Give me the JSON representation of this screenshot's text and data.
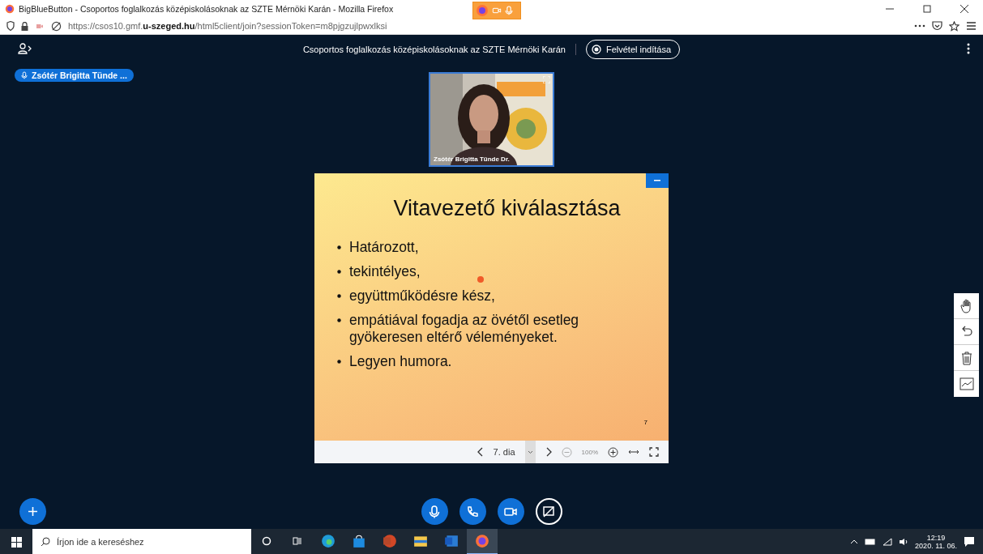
{
  "browser": {
    "title": "BigBlueButton - Csoportos foglalkozás középiskolásoknak az SZTE Mérnöki Karán - Mozilla Firefox",
    "url": "https://csos10.gmf.**u-szeged.hu**/html5client/join?sessionToken=m8pjgzujlpwxlksi"
  },
  "meeting": {
    "title": "Csoportos foglalkozás középiskolásoknak az SZTE Mérnöki Karán",
    "record_button": "Felvétel indítása",
    "talking_user": "Zsótér Brigitta Tünde ..."
  },
  "video": {
    "caption": "Zsótér Brigitta Tünde Dr."
  },
  "slide": {
    "title": "Vitavezető kiválasztása",
    "bullets": [
      "Határozott,",
      "tekintélyes,",
      "együttműködésre kész,",
      "empátiával fogadja az övétől esetleg gyökeresen eltérő véleményeket.",
      "Legyen humora."
    ],
    "page_number": "7"
  },
  "slide_toolbar": {
    "page": "7. dia",
    "zoom": "100%"
  },
  "actions": [
    {
      "kind": "mic",
      "on": true
    },
    {
      "kind": "phone",
      "on": true
    },
    {
      "kind": "camera",
      "on": true
    },
    {
      "kind": "screen",
      "on": false
    }
  ],
  "taskbar": {
    "search_placeholder": "Írjon ide a kereséshez",
    "time": "12:19",
    "date": "2020. 11. 06.",
    "apps": [
      {
        "kind": "edge",
        "selected": false
      },
      {
        "kind": "store",
        "selected": false
      },
      {
        "kind": "powerpoint",
        "selected": false
      },
      {
        "kind": "explorer",
        "selected": false
      },
      {
        "kind": "word",
        "selected": false
      },
      {
        "kind": "firefox",
        "selected": true
      }
    ]
  }
}
